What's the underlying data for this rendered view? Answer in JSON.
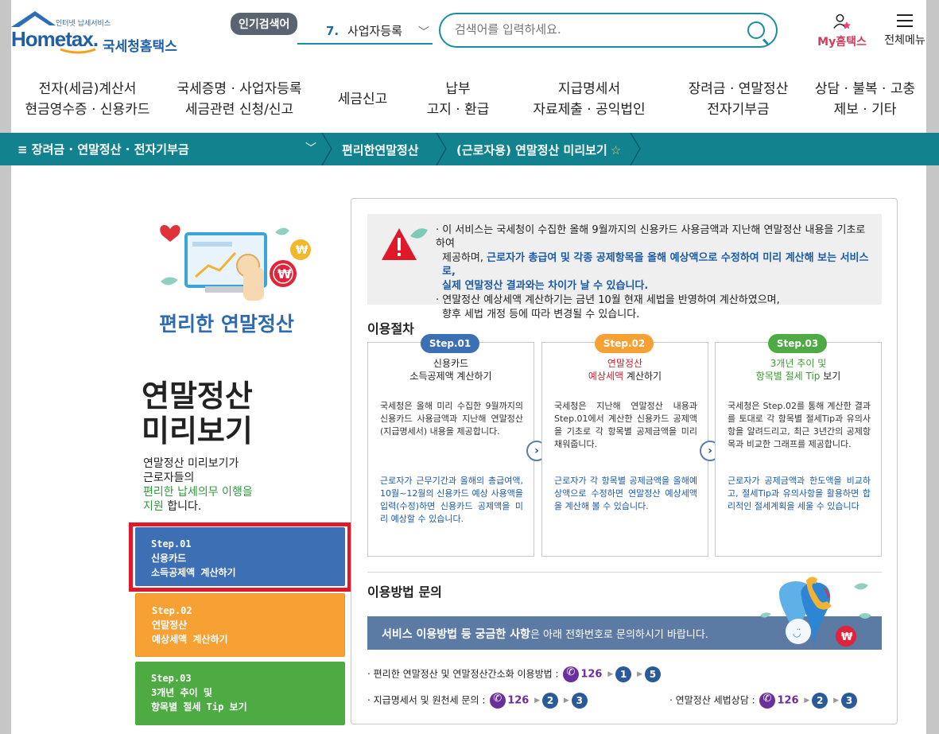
{
  "header": {
    "logo_slogan": "인터넷 납세서비스",
    "logo_text": "Hometax.",
    "logo_kor": "국세청홈택스",
    "popular_badge": "인기검색어",
    "popular_num": "7.",
    "popular_value": "사업자등록",
    "search_placeholder": "검색어를 입력하세요.",
    "my_label": "My홈택스",
    "allmenu_label": "전체메뉴"
  },
  "gnb": [
    "전자(세금)계산서\n현금영수증 · 신용카드",
    "국세증명 · 사업자등록\n세금관련 신청/신고",
    "세금신고",
    "납부\n고지 · 환급",
    "지급명세서\n자료제출 · 공익법인",
    "장려금 · 연말정산\n전자기부금",
    "상담 · 불복 · 고충\n제보 · 기타"
  ],
  "breadcrumb": {
    "menu": "≡  장려금 · 연말정산 · 전자기부금",
    "level2": "편리한연말정산",
    "level3": "(근로자용) 연말정산 미리보기"
  },
  "left": {
    "illust_title": "편리한 연말정산",
    "big_title": "연말정산\n미리보기",
    "desc_1": "연말정산 미리보기가",
    "desc_2": "근로자들의",
    "desc_3_green": "편리한 납세의무 이행을",
    "desc_4_green": "지원",
    "desc_4_rest": " 합니다.",
    "step1": "Step.01\n신용카드\n소득공제액 계산하기",
    "step2": "Step.02\n연말정산\n예상세액 계산하기",
    "step3": "Step.03\n3개년 추이 및\n항목별 절세 Tip 보기"
  },
  "notice": {
    "line1a": "· 이 서비스는 국세청이 수집한 올해 9월까지의 신용카드 사용금액과 지난해 연말정산 내용을 기초로 하여",
    "line1b_a": "제공하며, ",
    "line1b_blue": "근로자가 총급여 및 각종 공제항목을 올해 예상액으로 수정하여 미리 계산해 보는 서비스로,",
    "line1c_blue": "실제 연말정산 결과와는 차이가 날 수 있습니다.",
    "line2a": "· 연말정산 예상세액 계산하기는 금년 10월 현재 세법을 반영하여 계산하였으며,",
    "line2b": "향후 세법 개정 등에 따라 변경될 수 있습니다."
  },
  "procedure": {
    "title": "이용절차",
    "steps": [
      {
        "pill": "Step.01",
        "title": "신용카드\n소득공제액 계산하기",
        "text1": "국세청은 올해 미리 수집한 9월까지의 신용카드 사용금액과 지난해 연말정산(지급명세서) 내용을 제공합니다.",
        "text2": "근로자가 근무기간과 올해의 총급여액, 10월~12월의 신용카드 예상 사용액을 입력(수정)하면 신용카드 공제액을 미리 예상할 수 있습니다."
      },
      {
        "pill": "Step.02",
        "title_red1": "연말정산",
        "title_red2": "예상세액",
        "title_rest": " 계산하기",
        "text1": "국세청은 지난해 연말정산 내용과 Step.01에서 계산한 신용카드 공제액을 기초로 각 항목별 공제금액을 미리 채워줍니다.",
        "text2": "근로자가 각 항목별 공제금액을 올해예상액으로 수정하면 연말정산 예상세액을 계산해 볼 수 있습니다."
      },
      {
        "pill": "Step.03",
        "title_green1": "3개년 추이 및",
        "title_green2": "항목별 절세 Tip",
        "title_rest": " 보기",
        "text1": "국세청은 Step.02를 통해 계산한 결과를 토대로 각 항목별 절세Tip과 유의사항을 알려드리고, 최근 3년간의 공제항목과 비교한 그래프를 제공합니다.",
        "text2": "근로자가 공제금액과 한도액을 비교하고, 절세Tip과 유의사항을 활용하면 합리적인 절세계획을 세울 수 있습니다"
      }
    ]
  },
  "inquiry": {
    "title": "이용방법 문의",
    "banner_bold": "서비스 이용방법 등 궁금한 사항",
    "banner_rest": "은 아래 전화번호로 문의하시기 바랍니다.",
    "c1_label": "· 편리한 연말정산 및 연말정산간소화 이용방법 :",
    "c2_label": "· 지급명세서 및 원천세 문의 :",
    "c3_label": "· 연말정산 세법상담 :",
    "phone": "126",
    "c1_nums": [
      "1",
      "5"
    ],
    "c2_nums": [
      "2",
      "3"
    ],
    "c3_nums": [
      "2",
      "3"
    ]
  },
  "colors": {
    "teal": "#12828f",
    "step1": "#3d6fb4",
    "step2": "#f7a135",
    "step3": "#4eaa43",
    "highlight": "#e0192a"
  }
}
